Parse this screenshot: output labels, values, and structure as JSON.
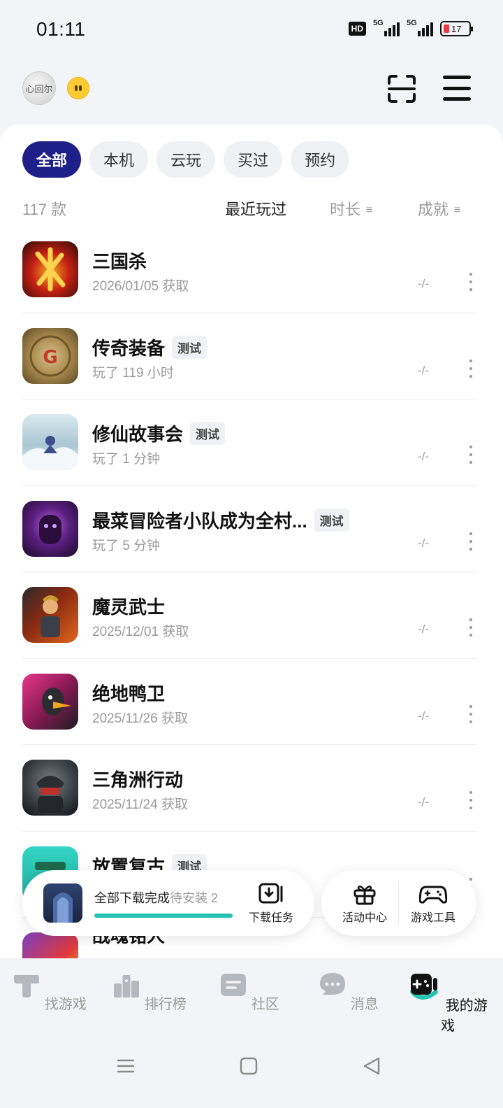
{
  "status_bar": {
    "time": "01:11",
    "hd": "HD",
    "sim1": "5G",
    "sim2": "5G",
    "battery": "17"
  },
  "header": {
    "avatar_text": "心回尔"
  },
  "filters": [
    "全部",
    "本机",
    "云玩",
    "买过",
    "预约"
  ],
  "sort": {
    "count": "117 款",
    "recent": "最近玩过",
    "duration": "时长",
    "achievement": "成就"
  },
  "games": [
    {
      "title": "三国杀",
      "tag": "",
      "sub": "2026/01/05 获取",
      "ach": "-/-",
      "icon_color": "#8b1a1a"
    },
    {
      "title": "传奇装备",
      "tag": "测试",
      "sub": "玩了 119 小时",
      "ach": "-/-",
      "icon_color": "#a58a4e"
    },
    {
      "title": "修仙故事会",
      "tag": "测试",
      "sub": "玩了 1 分钟",
      "ach": "-/-",
      "icon_color": "#8fb7c9"
    },
    {
      "title": "最菜冒险者小队成为全村...",
      "tag": "测试",
      "sub": "玩了 5 分钟",
      "ach": "-/-",
      "icon_color": "#4b1f6e"
    },
    {
      "title": "魔灵武士",
      "tag": "",
      "sub": "2025/12/01 获取",
      "ach": "-/-",
      "icon_color": "#b8401a"
    },
    {
      "title": "绝地鸭卫",
      "tag": "",
      "sub": "2025/11/26 获取",
      "ach": "-/-",
      "icon_color": "#c22a6a"
    },
    {
      "title": "三角洲行动",
      "tag": "",
      "sub": "2025/11/24 获取",
      "ach": "-/-",
      "icon_color": "#3a3f45"
    },
    {
      "title": "放置复古",
      "tag": "测试",
      "sub": "",
      "ach": "",
      "icon_color": "#2fc4b6"
    },
    {
      "title": "战魂铭人",
      "tag": "",
      "sub": "",
      "ach": "",
      "icon_color": "#7a3fc4"
    }
  ],
  "download": {
    "status": "全部下载完成",
    "pending": "待安装 2",
    "task_label": "下载任务",
    "progress": 1.0
  },
  "quick": {
    "activity": "活动中心",
    "tools": "游戏工具"
  },
  "bottom_nav": [
    "找游戏",
    "排行榜",
    "社区",
    "消息",
    "我的游戏"
  ],
  "colors": {
    "accent": "#1f1f8a",
    "teal": "#22c3b0",
    "muted": "#9a9a9a"
  }
}
